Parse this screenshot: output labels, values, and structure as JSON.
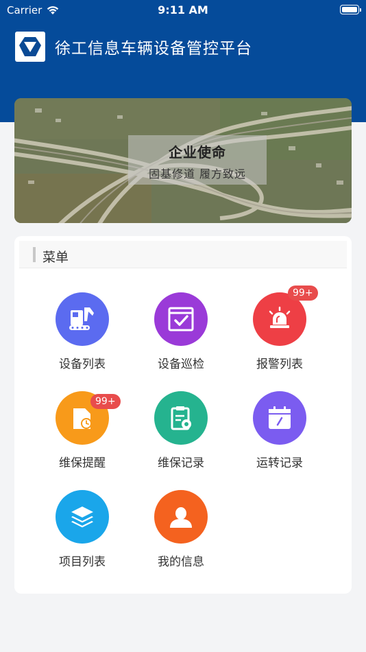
{
  "status_bar": {
    "carrier": "Carrier",
    "time": "9:11 AM"
  },
  "header": {
    "title": "徐工信息车辆设备管控平台",
    "logo_icon": "xcmg-logo-icon"
  },
  "banner": {
    "title": "企业使命",
    "subtitle": "固基修道  履方致远"
  },
  "menu": {
    "title": "菜单",
    "items": [
      {
        "label": "设备列表",
        "icon": "excavator-icon",
        "color": "#5b6bf0"
      },
      {
        "label": "设备巡检",
        "icon": "inspection-icon",
        "color": "#9a3ad8"
      },
      {
        "label": "报警列表",
        "icon": "alarm-icon",
        "color": "#ee3f45",
        "badge": "99+"
      },
      {
        "label": "维保提醒",
        "icon": "maintenance-reminder-icon",
        "color": "#f89a1a",
        "badge": "99+"
      },
      {
        "label": "维保记录",
        "icon": "maintenance-record-icon",
        "color": "#25b38f"
      },
      {
        "label": "运转记录",
        "icon": "calendar-icon",
        "color": "#7b5cf0"
      },
      {
        "label": "项目列表",
        "icon": "layers-icon",
        "color": "#1aa6ea"
      },
      {
        "label": "我的信息",
        "icon": "user-icon",
        "color": "#f4621f"
      }
    ]
  }
}
